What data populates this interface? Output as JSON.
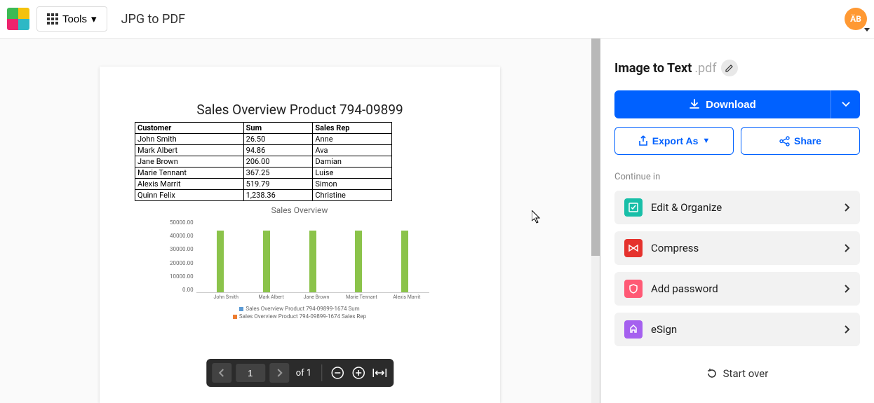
{
  "header": {
    "tools_label": "Tools",
    "page_title": "JPG to PDF",
    "avatar_initials": "ÄB"
  },
  "document": {
    "title": "Sales Overview Product 794-09899",
    "table": {
      "headers": [
        "Customer",
        "Sum",
        "Sales Rep"
      ],
      "rows": [
        [
          "John Smith",
          "26.50",
          "Anne"
        ],
        [
          "Mark Albert",
          "94.86",
          "Ava"
        ],
        [
          "Jane Brown",
          "206.00",
          "Damian"
        ],
        [
          "Marie Tennant",
          "367.25",
          "Luise"
        ],
        [
          "Alexis Marrit",
          "519.79",
          "Simon"
        ],
        [
          "Quinn Felix",
          "1,238.36",
          "Christine"
        ]
      ]
    }
  },
  "chart_data": {
    "type": "bar",
    "title": "Sales Overview",
    "categories": [
      "John Smith",
      "Mark Albert",
      "Jane Brown",
      "Marie Tennant",
      "Alexis Marrit"
    ],
    "series": [
      {
        "name": "Sales Overview Product 794-09899-1674 Sum",
        "values": [
          42000,
          42000,
          42000,
          42000,
          42000
        ],
        "color": "#5b9bd5"
      },
      {
        "name": "Sales Overview Product 794-09899-1674 Sales Rep",
        "values": [
          0,
          0,
          0,
          0,
          0
        ],
        "color": "#ed7d31"
      }
    ],
    "ylim": [
      0,
      50000
    ],
    "yticks": [
      "50000.00",
      "40000.00",
      "30000.00",
      "20000.00",
      "10000.00",
      "0.00"
    ]
  },
  "page_controls": {
    "current": "1",
    "of_label": "of 1"
  },
  "sidebar": {
    "file_name": "Image to Text",
    "file_ext": ".pdf",
    "download": "Download",
    "export_as": "Export As",
    "share": "Share",
    "continue_label": "Continue in",
    "items": [
      {
        "label": "Edit & Organize",
        "icon_bg": "#18bfa8"
      },
      {
        "label": "Compress",
        "icon_bg": "#e5322d"
      },
      {
        "label": "Add password",
        "icon_bg": "#ff5975"
      },
      {
        "label": "eSign",
        "icon_bg": "#a560ef"
      }
    ],
    "start_over": "Start over"
  }
}
